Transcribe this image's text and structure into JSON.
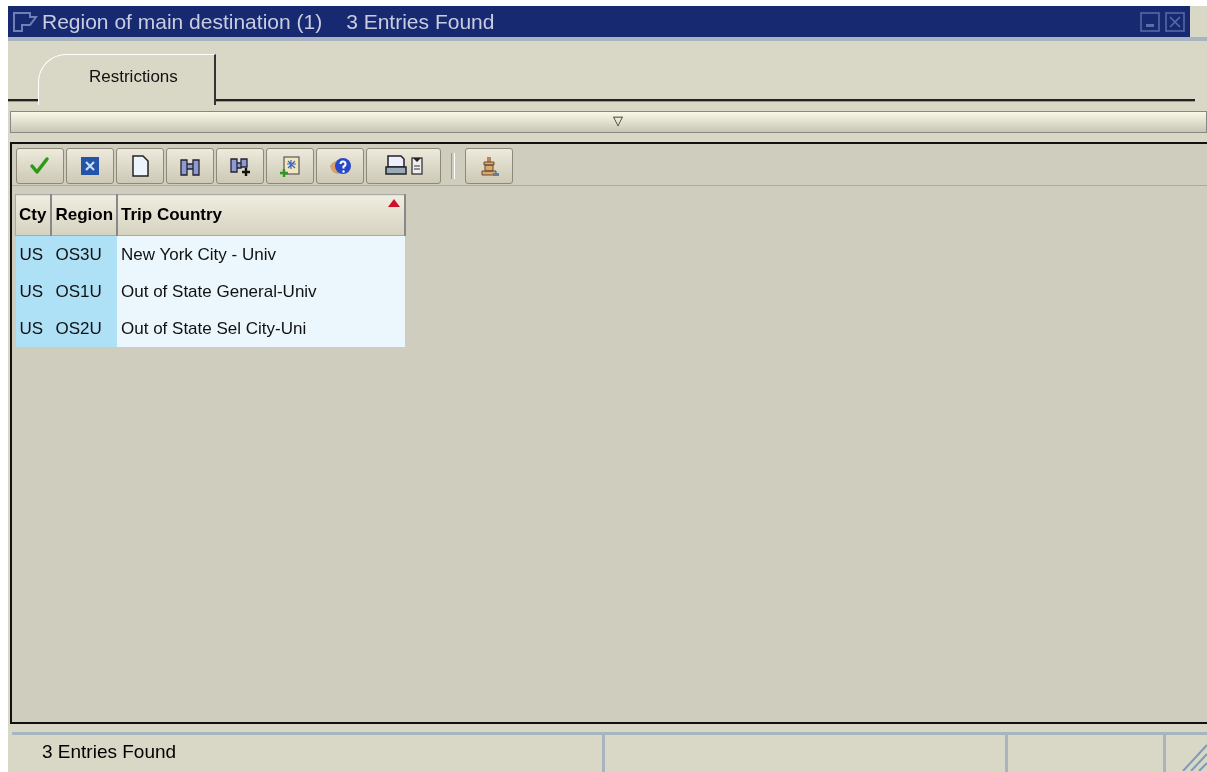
{
  "window": {
    "title": "Region of main destination (1)",
    "subtitle": "3 Entries Found"
  },
  "tabs": [
    {
      "label": "Restrictions",
      "selected": true
    }
  ],
  "collapse_toggle": "▽",
  "toolbar": [
    {
      "kind": "check"
    },
    {
      "kind": "cancel"
    },
    {
      "kind": "page"
    },
    {
      "kind": "find"
    },
    {
      "kind": "find-next"
    },
    {
      "kind": "new"
    },
    {
      "kind": "help"
    },
    {
      "kind": "print"
    },
    {
      "kind": "separator"
    },
    {
      "kind": "spool"
    }
  ],
  "table": {
    "columns": [
      {
        "label": "Cty",
        "sorted": false
      },
      {
        "label": "Region",
        "sorted": false
      },
      {
        "label": "Trip Country",
        "sorted": true
      }
    ],
    "rows": [
      [
        "US",
        "OS3U",
        "New York City - Univ"
      ],
      [
        "US",
        "OS1U",
        "Out of State General-Univ"
      ],
      [
        "US",
        "OS2U",
        "Out of State Sel City-Uni"
      ]
    ]
  },
  "status_bar": {
    "message": "3 Entries Found"
  }
}
